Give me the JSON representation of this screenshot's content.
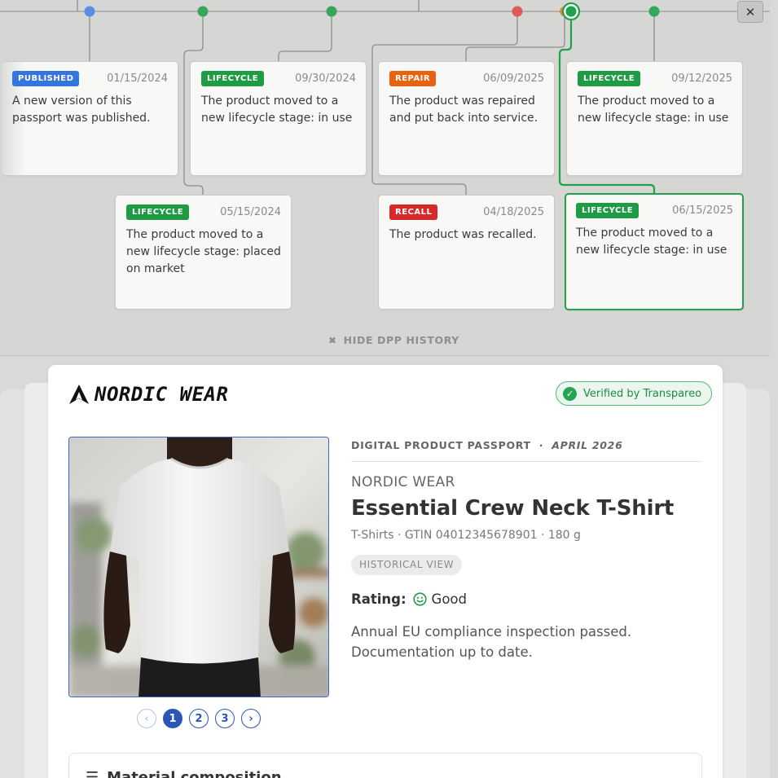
{
  "timeline": {
    "close_label": "✕",
    "hide_label": "HIDE DPP HISTORY",
    "dots": [
      {
        "color": "#5a8ee6"
      },
      {
        "color": "#35a65b"
      },
      {
        "color": "#35a65b"
      },
      {
        "color": "#e05a5a"
      },
      {
        "color": "#1ea24a",
        "selected": true
      },
      {
        "color": "#35a65b"
      }
    ],
    "events": [
      {
        "type": "PUBLISHED",
        "kind": "published",
        "date": "01/15/2024",
        "text": "A new version of this passport was published."
      },
      {
        "type": "LIFECYCLE",
        "kind": "lifecycle",
        "date": "09/30/2024",
        "text": "The product moved to a new lifecycle stage: in use"
      },
      {
        "type": "REPAIR",
        "kind": "repair",
        "date": "06/09/2025",
        "text": "The product was repaired and put back into service."
      },
      {
        "type": "LIFECYCLE",
        "kind": "lifecycle",
        "date": "09/12/2025",
        "text": "The product moved to a new lifecycle stage: in use"
      },
      {
        "type": "LIFECYCLE",
        "kind": "lifecycle",
        "date": "05/15/2024",
        "text": "The product moved to a new lifecycle stage: placed on market"
      },
      {
        "type": "RECALL",
        "kind": "recall",
        "date": "04/18/2025",
        "text": "The product was recalled."
      },
      {
        "type": "LIFECYCLE",
        "kind": "lifecycle",
        "date": "06/15/2025",
        "text": "The product moved to a new lifecycle stage: in use",
        "selected": true
      }
    ]
  },
  "passport": {
    "brand": "NORDIC WEAR",
    "verified": "Verified by Transpareo",
    "eyebrow": "DIGITAL PRODUCT PASSPORT",
    "eyebrow_sep": "·",
    "eyebrow_date": "APRIL 2026",
    "brand_label": "NORDIC WEAR",
    "title": "Essential Crew Neck T-Shirt",
    "meta": "T-Shirts · GTIN 04012345678901 · 180 g",
    "chip": "HISTORICAL VIEW",
    "rating_label": "Rating:",
    "rating_value": "Good",
    "description": "Annual EU compliance inspection passed. Documentation up to date.",
    "pages": [
      "1",
      "2",
      "3"
    ],
    "current_page": "1",
    "materials_title": "Material composition",
    "colors": {
      "accent": "#2a56b8",
      "verified": "#1f8a46"
    }
  }
}
